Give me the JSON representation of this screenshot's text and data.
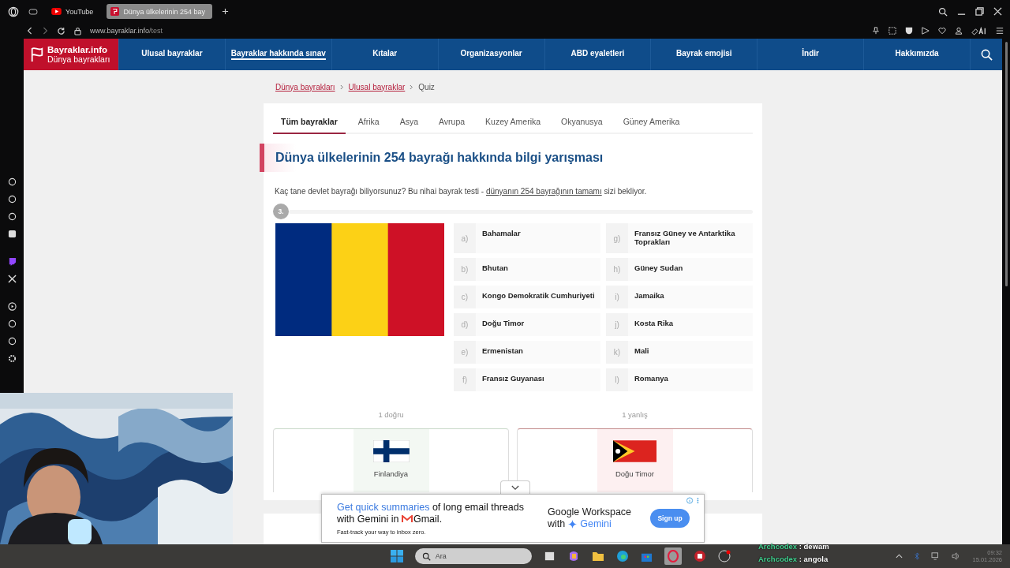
{
  "browser": {
    "tabs": [
      {
        "title": "YouTube",
        "selected": false
      },
      {
        "title": "Dünya ülkelerinin 254 bay",
        "selected": true
      }
    ],
    "address": {
      "domain": "www.bayraklar.info",
      "path": "/test"
    }
  },
  "site": {
    "logo_title": "Bayraklar.info",
    "logo_subtitle": "Dünya bayrakları",
    "nav": [
      {
        "label": "Ulusal bayraklar",
        "selected": false
      },
      {
        "label": "Bayraklar hakkında sınav",
        "selected": true
      },
      {
        "label": "Kıtalar",
        "selected": false
      },
      {
        "label": "Organizasyonlar",
        "selected": false
      },
      {
        "label": "ABD eyaletleri",
        "selected": false
      },
      {
        "label": "Bayrak emojisi",
        "selected": false
      },
      {
        "label": "İndir",
        "selected": false
      },
      {
        "label": "Hakkımızda",
        "selected": false
      }
    ]
  },
  "breadcrumb": [
    {
      "label": "Dünya bayrakları",
      "kind": "link"
    },
    {
      "label": "Ulusal bayraklar",
      "kind": "link"
    },
    {
      "label": "Quiz",
      "kind": "current"
    }
  ],
  "tabs": [
    {
      "label": "Tüm bayraklar",
      "selected": true
    },
    {
      "label": "Afrika",
      "selected": false
    },
    {
      "label": "Asya",
      "selected": false
    },
    {
      "label": "Avrupa",
      "selected": false
    },
    {
      "label": "Kuzey Amerika",
      "selected": false
    },
    {
      "label": "Okyanusya",
      "selected": false
    },
    {
      "label": "Güney Amerika",
      "selected": false
    }
  ],
  "quiz": {
    "title": "Dünya ülkelerinin 254 bayrağı hakkında bilgi yarışması",
    "intro_before": "Kaç tane devlet bayrağı biliyorsunuz? Bu nihai bayrak testi - ",
    "intro_link": "dünyanın 254 bayrağının tamamı",
    "intro_after": " sizi bekliyor.",
    "question_number": "3.",
    "options": [
      {
        "letter": "a)",
        "name": "Bahamalar"
      },
      {
        "letter": "b)",
        "name": "Bhutan"
      },
      {
        "letter": "c)",
        "name": "Kongo Demokratik Cumhuriyeti"
      },
      {
        "letter": "d)",
        "name": "Doğu Timor"
      },
      {
        "letter": "e)",
        "name": "Ermenistan"
      },
      {
        "letter": "f)",
        "name": "Fransız Guyanası"
      },
      {
        "letter": "g)",
        "name": "Fransız Güney ve Antarktika Toprakları"
      },
      {
        "letter": "h)",
        "name": "Güney Sudan"
      },
      {
        "letter": "i)",
        "name": "Jamaika"
      },
      {
        "letter": "j)",
        "name": "Kosta Rika"
      },
      {
        "letter": "k)",
        "name": "Mali"
      },
      {
        "letter": "l)",
        "name": "Romanya"
      }
    ],
    "results": [
      {
        "count": "1 doğru",
        "kind": "correct",
        "name": "Finlandiya"
      },
      {
        "count": "1 yanlış",
        "kind": "wrong",
        "name": "Doğu Timor"
      }
    ]
  },
  "ad": {
    "headline_highlight": "Get quick summaries",
    "headline_rest": " of long email threads with Gemini in",
    "brand": "Gmail.",
    "tagline": "Fast-track your way to inbox zero.",
    "sponsor": "Google Workspace",
    "sponsor_with": "with",
    "sponsor_product": "Gemini",
    "button": "Sign up"
  },
  "taskbar": {
    "search_placeholder": "Ara",
    "time": "09:32",
    "date": "15.01.2026"
  },
  "chat": [
    {
      "user": "Archcodex",
      "message": ": dewam"
    },
    {
      "user": "Archcodex",
      "message": ": angola"
    }
  ]
}
